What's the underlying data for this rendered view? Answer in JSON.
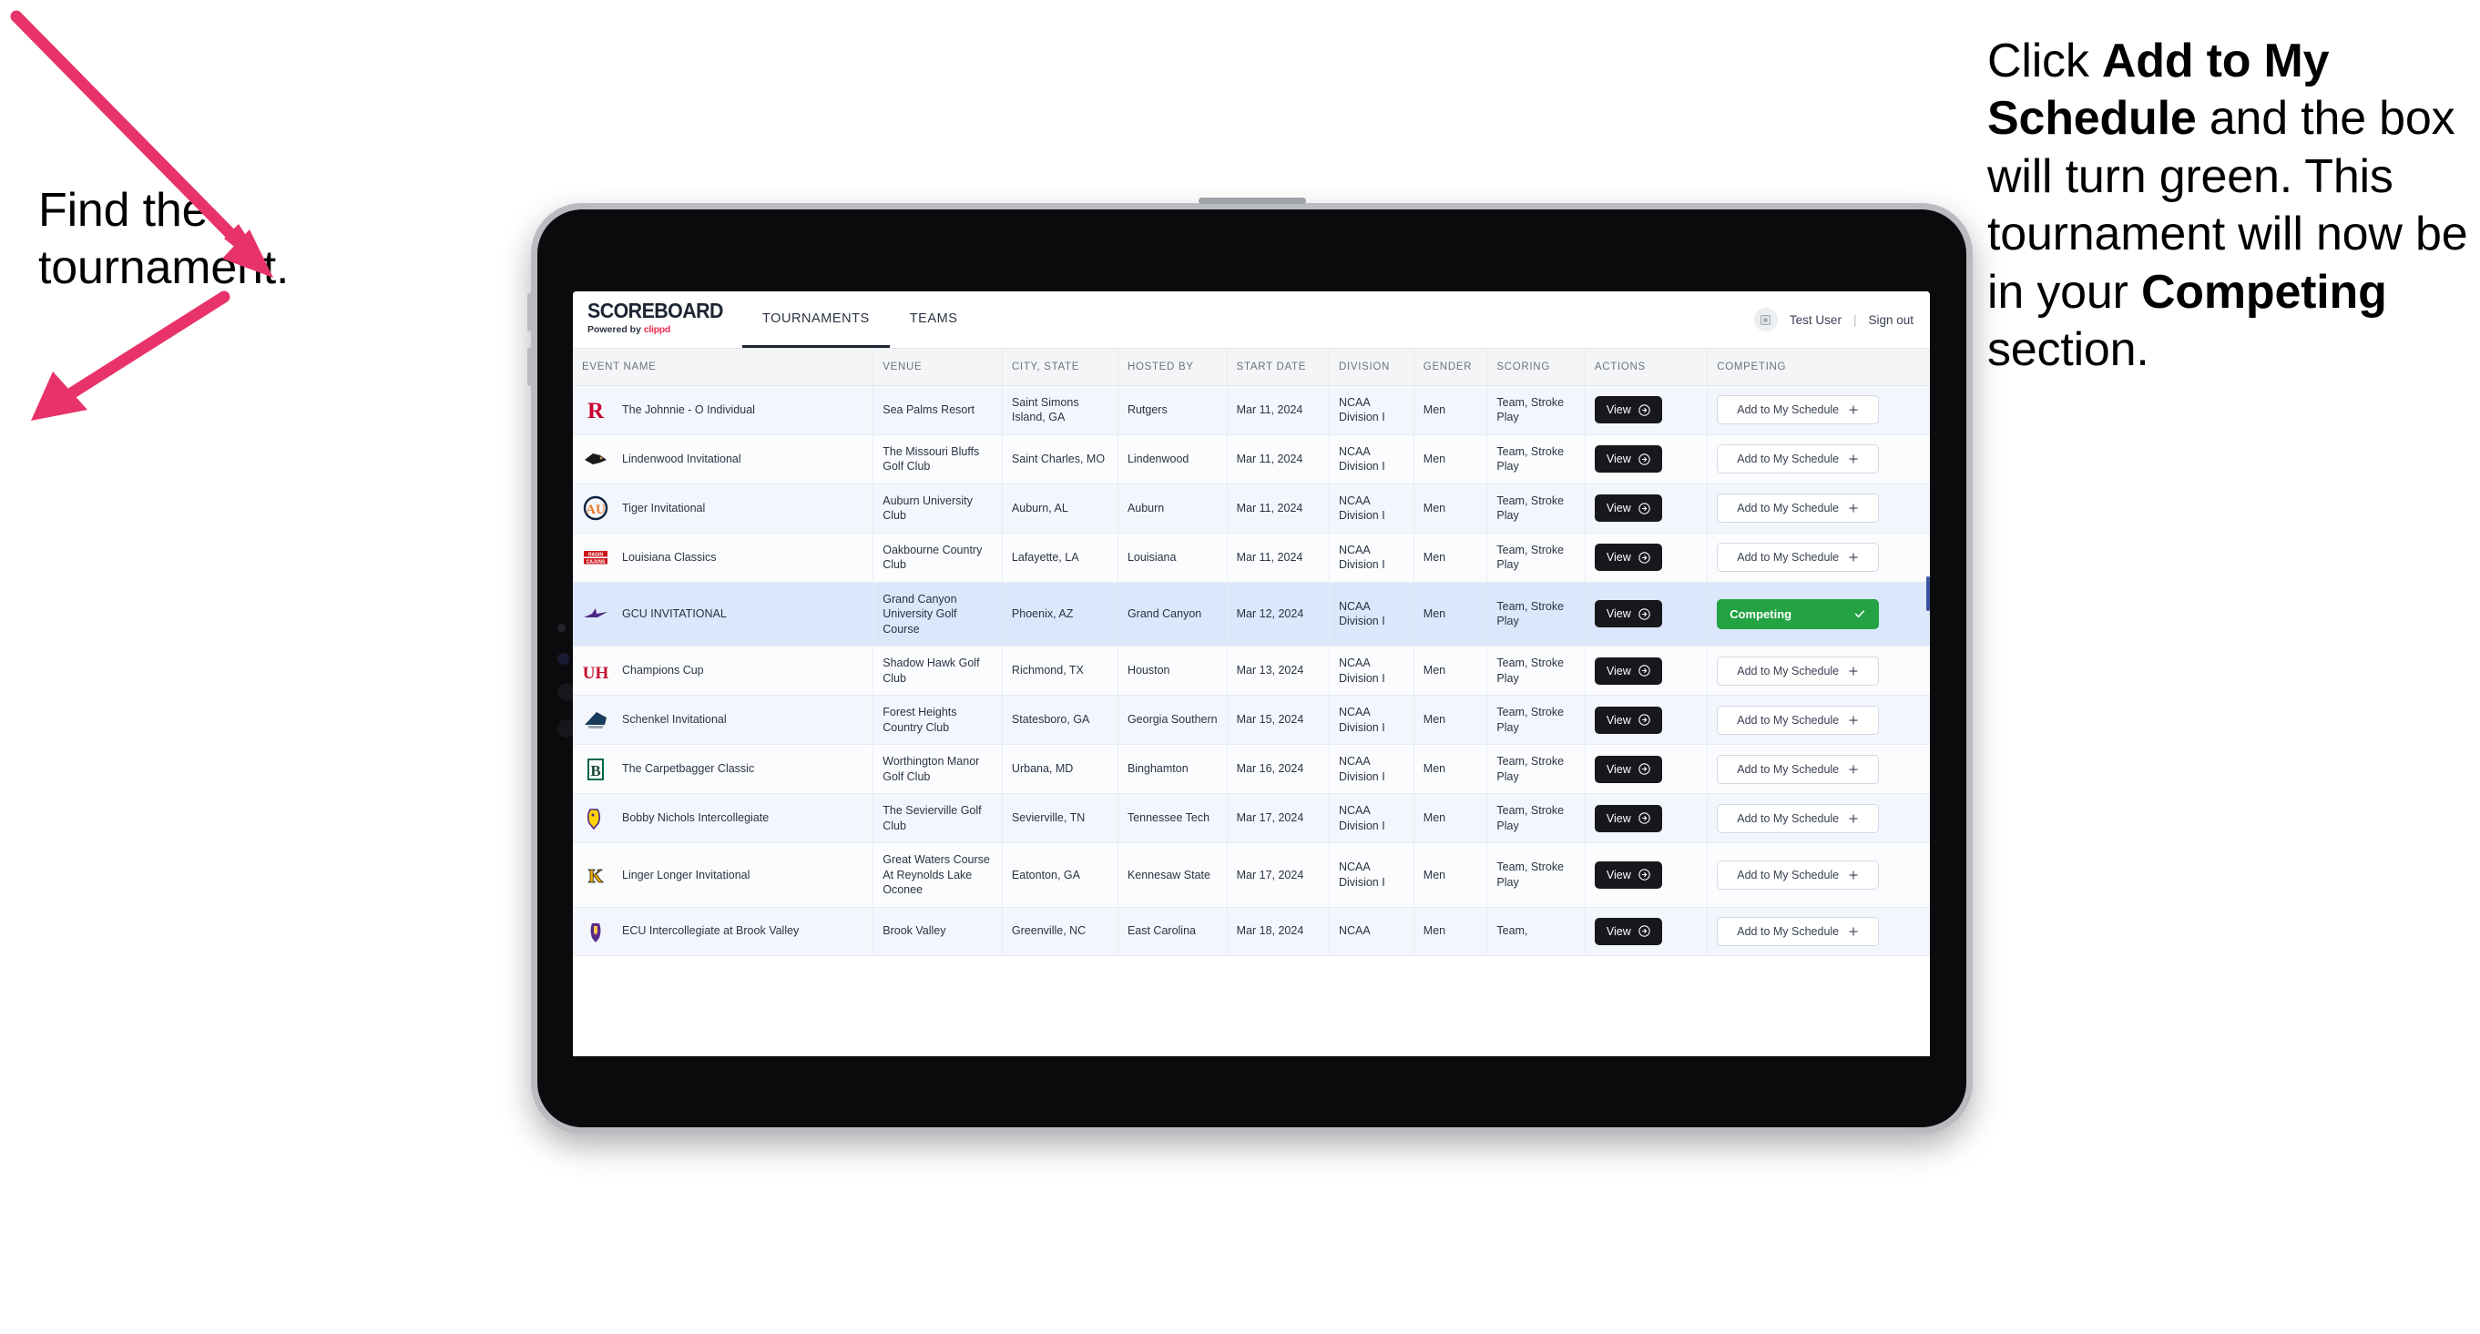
{
  "annotations": {
    "left": "Find the tournament.",
    "right_parts": [
      {
        "text": "Click ",
        "bold": false
      },
      {
        "text": "Add to My Schedule",
        "bold": true
      },
      {
        "text": " and the box will turn green. This tournament will now be in your ",
        "bold": false
      },
      {
        "text": "Competing",
        "bold": true
      },
      {
        "text": " section.",
        "bold": false
      }
    ],
    "arrow_color": "#e8336a"
  },
  "app": {
    "brand": {
      "title": "SCOREBOARD",
      "powered_prefix": "Powered by ",
      "powered_brand": "clippd"
    },
    "nav": [
      {
        "label": "TOURNAMENTS",
        "active": true
      },
      {
        "label": "TEAMS",
        "active": false
      }
    ],
    "account": {
      "avatar_icon": "user-avatar-icon",
      "user": "Test User",
      "separator": "|",
      "signout": "Sign out"
    },
    "table": {
      "columns": [
        "EVENT NAME",
        "VENUE",
        "CITY, STATE",
        "HOSTED BY",
        "START DATE",
        "DIVISION",
        "GENDER",
        "SCORING",
        "ACTIONS",
        "COMPETING"
      ],
      "view_label": "View",
      "add_label": "Add to My Schedule",
      "competing_label": "Competing",
      "rows": [
        {
          "logo": "rutgers-logo",
          "event": "The Johnnie - O Individual",
          "venue": "Sea Palms Resort",
          "city": "Saint Simons Island, GA",
          "host": "Rutgers",
          "date": "Mar 11, 2024",
          "division": "NCAA Division I",
          "gender": "Men",
          "scoring": "Team, Stroke Play",
          "competing": false
        },
        {
          "logo": "lindenwood-logo",
          "event": "Lindenwood Invitational",
          "venue": "The Missouri Bluffs Golf Club",
          "city": "Saint Charles, MO",
          "host": "Lindenwood",
          "date": "Mar 11, 2024",
          "division": "NCAA Division I",
          "gender": "Men",
          "scoring": "Team, Stroke Play",
          "competing": false
        },
        {
          "logo": "auburn-logo",
          "event": "Tiger Invitational",
          "venue": "Auburn University Club",
          "city": "Auburn, AL",
          "host": "Auburn",
          "date": "Mar 11, 2024",
          "division": "NCAA Division I",
          "gender": "Men",
          "scoring": "Team, Stroke Play",
          "competing": false
        },
        {
          "logo": "louisiana-logo",
          "event": "Louisiana Classics",
          "venue": "Oakbourne Country Club",
          "city": "Lafayette, LA",
          "host": "Louisiana",
          "date": "Mar 11, 2024",
          "division": "NCAA Division I",
          "gender": "Men",
          "scoring": "Team, Stroke Play",
          "competing": false
        },
        {
          "logo": "gcu-logo",
          "event": "GCU INVITATIONAL",
          "venue": "Grand Canyon University Golf Course",
          "city": "Phoenix, AZ",
          "host": "Grand Canyon",
          "date": "Mar 12, 2024",
          "division": "NCAA Division I",
          "gender": "Men",
          "scoring": "Team, Stroke Play",
          "competing": true,
          "selected": true
        },
        {
          "logo": "houston-logo",
          "event": "Champions Cup",
          "venue": "Shadow Hawk Golf Club",
          "city": "Richmond, TX",
          "host": "Houston",
          "date": "Mar 13, 2024",
          "division": "NCAA Division I",
          "gender": "Men",
          "scoring": "Team, Stroke Play",
          "competing": false
        },
        {
          "logo": "georgia-southern-logo",
          "event": "Schenkel Invitational",
          "venue": "Forest Heights Country Club",
          "city": "Statesboro, GA",
          "host": "Georgia Southern",
          "date": "Mar 15, 2024",
          "division": "NCAA Division I",
          "gender": "Men",
          "scoring": "Team, Stroke Play",
          "competing": false
        },
        {
          "logo": "binghamton-logo",
          "event": "The Carpetbagger Classic",
          "venue": "Worthington Manor Golf Club",
          "city": "Urbana, MD",
          "host": "Binghamton",
          "date": "Mar 16, 2024",
          "division": "NCAA Division I",
          "gender": "Men",
          "scoring": "Team, Stroke Play",
          "competing": false
        },
        {
          "logo": "tennessee-tech-logo",
          "event": "Bobby Nichols Intercollegiate",
          "venue": "The Sevierville Golf Club",
          "city": "Sevierville, TN",
          "host": "Tennessee Tech",
          "date": "Mar 17, 2024",
          "division": "NCAA Division I",
          "gender": "Men",
          "scoring": "Team, Stroke Play",
          "competing": false
        },
        {
          "logo": "kennesaw-state-logo",
          "event": "Linger Longer Invitational",
          "venue": "Great Waters Course At Reynolds Lake Oconee",
          "city": "Eatonton, GA",
          "host": "Kennesaw State",
          "date": "Mar 17, 2024",
          "division": "NCAA Division I",
          "gender": "Men",
          "scoring": "Team, Stroke Play",
          "competing": false
        },
        {
          "logo": "east-carolina-logo",
          "event": "ECU Intercollegiate at Brook Valley",
          "venue": "Brook Valley",
          "city": "Greenville, NC",
          "host": "East Carolina",
          "date": "Mar 18, 2024",
          "division": "NCAA",
          "gender": "Men",
          "scoring": "Team,",
          "competing": false,
          "partial": true
        }
      ]
    }
  },
  "colors": {
    "accent_pink": "#e8336a",
    "competing_green": "#23a343",
    "selected_row": "#dbe7fb",
    "row_even": "#f3f7fd",
    "row_odd": "#fbfcfe",
    "dark_button": "#17181c"
  }
}
